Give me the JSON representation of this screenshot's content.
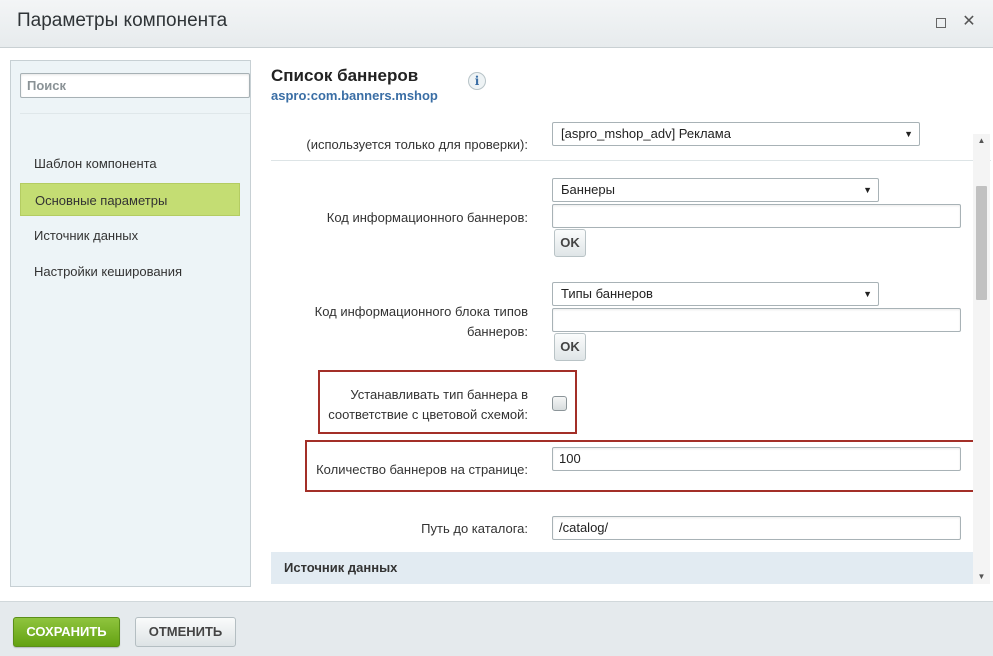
{
  "window": {
    "title": "Параметры компонента"
  },
  "sidebar": {
    "search_placeholder": "Поиск",
    "items": [
      {
        "label": "Шаблон компонента"
      },
      {
        "label": "Основные параметры"
      },
      {
        "label": "Источник данных"
      },
      {
        "label": "Настройки кеширования"
      }
    ],
    "active_index": 1
  },
  "component": {
    "title": "Список баннеров",
    "code": "aspro:com.banners.mshop",
    "info_icon": "i"
  },
  "form": {
    "check_label": "(используется только для проверки):",
    "check_select_value": "[aspro_mshop_adv] Реклама",
    "iblock_label": "Код информационного баннеров:",
    "iblock_select_value": "Баннеры",
    "iblock_input_value": "",
    "ok_label": "OK",
    "types_label_line1": "Код информационного блока типов",
    "types_label_line2": "баннеров:",
    "types_select_value": "Типы баннеров",
    "types_input_value": "",
    "color_label_line1": "Устанавливать тип баннера в",
    "color_label_line2": "соответствие с цветовой схемой:",
    "color_checked": false,
    "count_label": "Количество баннеров на странице:",
    "count_value": "100",
    "catalog_label": "Путь до каталога:",
    "catalog_value": "/catalog/"
  },
  "section": {
    "label": "Источник данных"
  },
  "footer": {
    "save_label": "СОХРАНИТЬ",
    "cancel_label": "ОТМЕНИТЬ"
  },
  "colors": {
    "save_button": "#6aa518",
    "active_sidebar": "#c4dd73",
    "highlight_border": "#a32f28",
    "link_code": "#3a6ea5"
  },
  "icons": {
    "maximize": "maximize-icon",
    "close": "close-icon",
    "info": "info-icon",
    "dropdown": "chevron-down-icon"
  }
}
